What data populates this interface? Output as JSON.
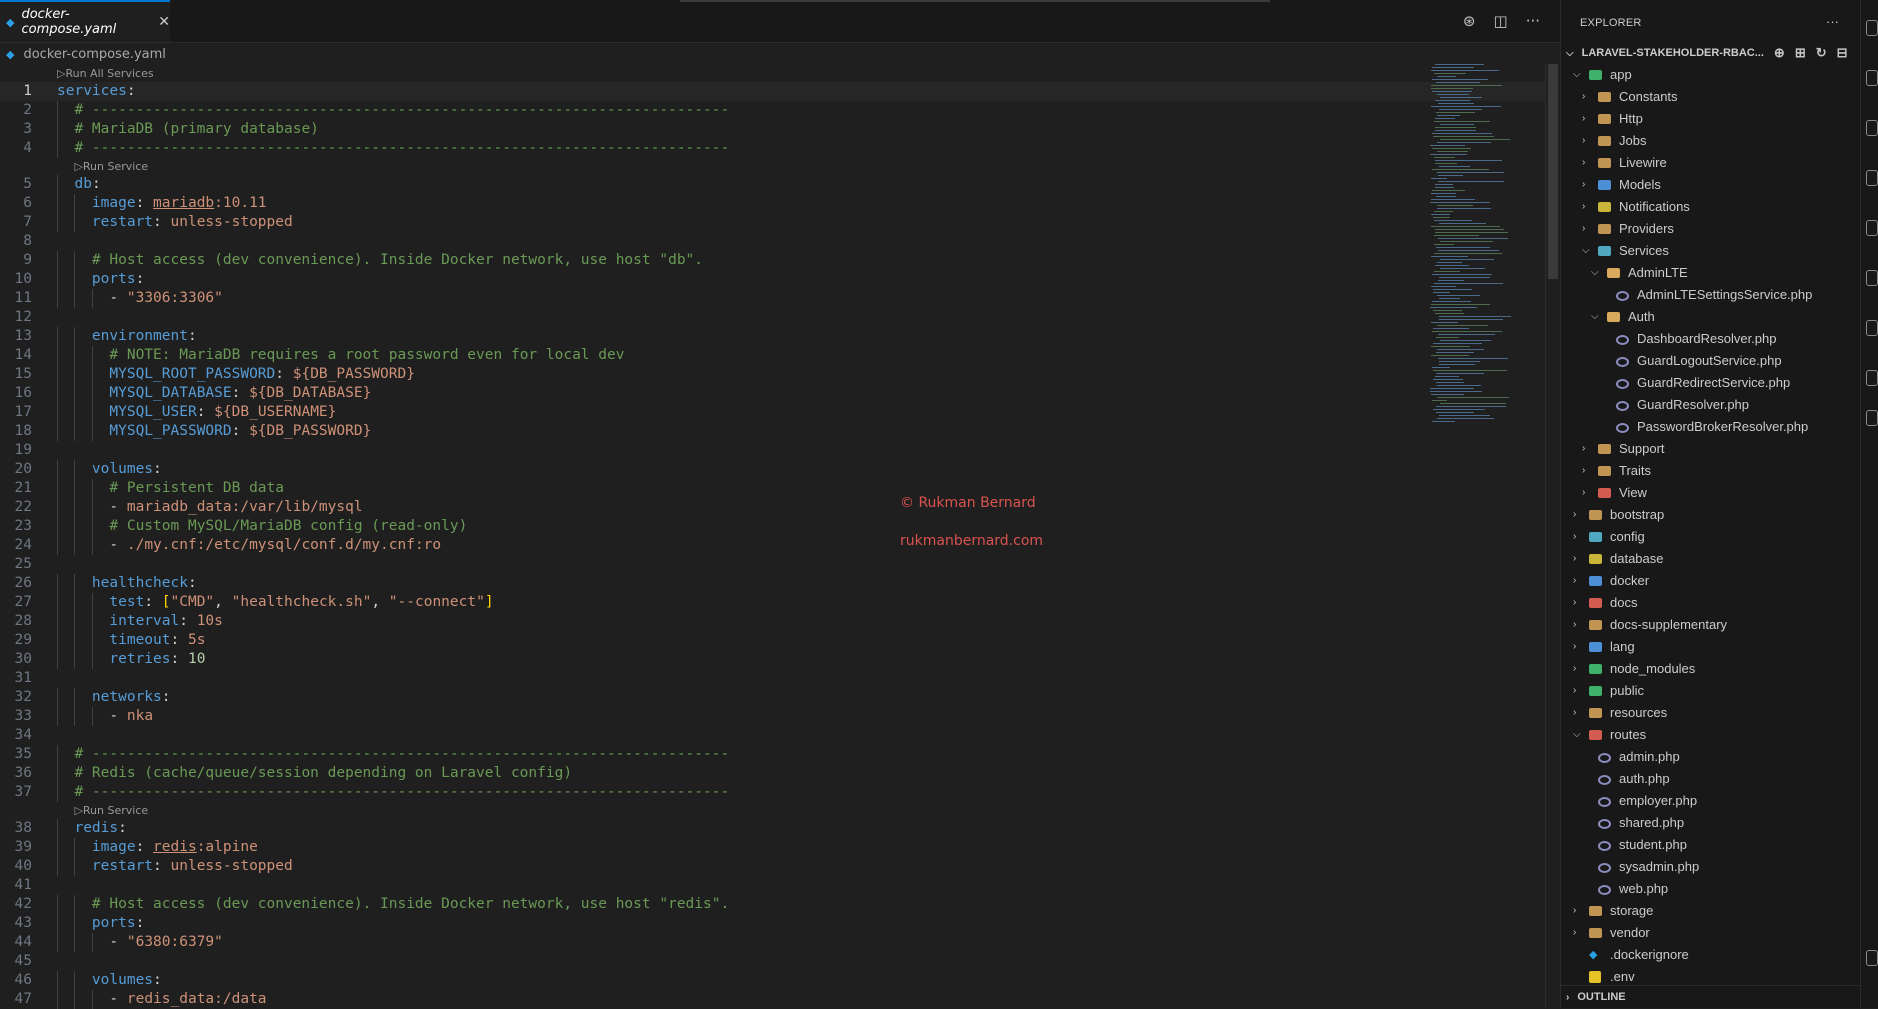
{
  "tab": {
    "label": "docker-compose.yaml",
    "close": "✕",
    "icon": "whale-icon"
  },
  "tab_actions": [
    "copilot-icon",
    "split-editor-icon",
    "more-icon"
  ],
  "breadcrumb": {
    "file": "docker-compose.yaml"
  },
  "codelens": {
    "run_all": "▷Run All Services",
    "run_service": "▷Run Service"
  },
  "code_lines": [
    {
      "n": "1",
      "t": "services:"
    },
    {
      "n": "2",
      "t": "  # -------------------------------------------------------------------------"
    },
    {
      "n": "3",
      "t": "  # MariaDB (primary database)"
    },
    {
      "n": "4",
      "t": "  # -------------------------------------------------------------------------"
    },
    {
      "n": "5",
      "t": "  db:"
    },
    {
      "n": "6",
      "t": "    image: mariadb:10.11"
    },
    {
      "n": "7",
      "t": "    restart: unless-stopped"
    },
    {
      "n": "8",
      "t": ""
    },
    {
      "n": "9",
      "t": "    # Host access (dev convenience). Inside Docker network, use host \"db\"."
    },
    {
      "n": "10",
      "t": "    ports:"
    },
    {
      "n": "11",
      "t": "      - \"3306:3306\""
    },
    {
      "n": "12",
      "t": ""
    },
    {
      "n": "13",
      "t": "    environment:"
    },
    {
      "n": "14",
      "t": "      # NOTE: MariaDB requires a root password even for local dev"
    },
    {
      "n": "15",
      "t": "      MYSQL_ROOT_PASSWORD: ${DB_PASSWORD}"
    },
    {
      "n": "16",
      "t": "      MYSQL_DATABASE: ${DB_DATABASE}"
    },
    {
      "n": "17",
      "t": "      MYSQL_USER: ${DB_USERNAME}"
    },
    {
      "n": "18",
      "t": "      MYSQL_PASSWORD: ${DB_PASSWORD}"
    },
    {
      "n": "19",
      "t": ""
    },
    {
      "n": "20",
      "t": "    volumes:"
    },
    {
      "n": "21",
      "t": "      # Persistent DB data"
    },
    {
      "n": "22",
      "t": "      - mariadb_data:/var/lib/mysql"
    },
    {
      "n": "23",
      "t": "      # Custom MySQL/MariaDB config (read-only)"
    },
    {
      "n": "24",
      "t": "      - ./my.cnf:/etc/mysql/conf.d/my.cnf:ro"
    },
    {
      "n": "25",
      "t": ""
    },
    {
      "n": "26",
      "t": "    healthcheck:"
    },
    {
      "n": "27",
      "t": "      test: [\"CMD\", \"healthcheck.sh\", \"--connect\"]"
    },
    {
      "n": "28",
      "t": "      interval: 10s"
    },
    {
      "n": "29",
      "t": "      timeout: 5s"
    },
    {
      "n": "30",
      "t": "      retries: 10"
    },
    {
      "n": "31",
      "t": ""
    },
    {
      "n": "32",
      "t": "    networks:"
    },
    {
      "n": "33",
      "t": "      - nka"
    },
    {
      "n": "34",
      "t": ""
    },
    {
      "n": "35",
      "t": "  # -------------------------------------------------------------------------"
    },
    {
      "n": "36",
      "t": "  # Redis (cache/queue/session depending on Laravel config)"
    },
    {
      "n": "37",
      "t": "  # -------------------------------------------------------------------------"
    },
    {
      "n": "38",
      "t": "  redis:"
    },
    {
      "n": "39",
      "t": "    image: redis:alpine"
    },
    {
      "n": "40",
      "t": "    restart: unless-stopped"
    },
    {
      "n": "41",
      "t": ""
    },
    {
      "n": "42",
      "t": "    # Host access (dev convenience). Inside Docker network, use host \"redis\"."
    },
    {
      "n": "43",
      "t": "    ports:"
    },
    {
      "n": "44",
      "t": "      - \"6380:6379\""
    },
    {
      "n": "45",
      "t": ""
    },
    {
      "n": "46",
      "t": "    volumes:"
    },
    {
      "n": "47",
      "t": "      - redis_data:/data"
    }
  ],
  "watermark": {
    "line1": "© Rukman Bernard",
    "line2": "rukmanbernard.com"
  },
  "explorer": {
    "header": "EXPLORER",
    "more": "···",
    "root": "LARAVEL-STAKEHOLDER-RBAC...",
    "outline": "OUTLINE",
    "tree": [
      {
        "label": "app",
        "depth": 0,
        "type": "folder",
        "open": true,
        "color": "c-green"
      },
      {
        "label": "Constants",
        "depth": 1,
        "type": "folder",
        "open": false,
        "color": "folder"
      },
      {
        "label": "Http",
        "depth": 1,
        "type": "folder",
        "open": false,
        "color": "folder"
      },
      {
        "label": "Jobs",
        "depth": 1,
        "type": "folder",
        "open": false,
        "color": "folder"
      },
      {
        "label": "Livewire",
        "depth": 1,
        "type": "folder",
        "open": false,
        "color": "folder"
      },
      {
        "label": "Models",
        "depth": 1,
        "type": "folder",
        "open": false,
        "color": "c-blue"
      },
      {
        "label": "Notifications",
        "depth": 1,
        "type": "folder",
        "open": false,
        "color": "c-yellow"
      },
      {
        "label": "Providers",
        "depth": 1,
        "type": "folder",
        "open": false,
        "color": "folder"
      },
      {
        "label": "Services",
        "depth": 1,
        "type": "folder",
        "open": true,
        "color": "c-teal"
      },
      {
        "label": "AdminLTE",
        "depth": 2,
        "type": "folder",
        "open": true,
        "color": "folder-open"
      },
      {
        "label": "AdminLTESettingsService.php",
        "depth": 3,
        "type": "php"
      },
      {
        "label": "Auth",
        "depth": 2,
        "type": "folder",
        "open": true,
        "color": "folder-open"
      },
      {
        "label": "DashboardResolver.php",
        "depth": 3,
        "type": "php"
      },
      {
        "label": "GuardLogoutService.php",
        "depth": 3,
        "type": "php"
      },
      {
        "label": "GuardRedirectService.php",
        "depth": 3,
        "type": "php"
      },
      {
        "label": "GuardResolver.php",
        "depth": 3,
        "type": "php"
      },
      {
        "label": "PasswordBrokerResolver.php",
        "depth": 3,
        "type": "php"
      },
      {
        "label": "Support",
        "depth": 1,
        "type": "folder",
        "open": false,
        "color": "folder"
      },
      {
        "label": "Traits",
        "depth": 1,
        "type": "folder",
        "open": false,
        "color": "folder"
      },
      {
        "label": "View",
        "depth": 1,
        "type": "folder",
        "open": false,
        "color": "c-red"
      },
      {
        "label": "bootstrap",
        "depth": 0,
        "type": "folder",
        "open": false,
        "color": "folder"
      },
      {
        "label": "config",
        "depth": 0,
        "type": "folder",
        "open": false,
        "color": "c-teal"
      },
      {
        "label": "database",
        "depth": 0,
        "type": "folder",
        "open": false,
        "color": "c-yellow"
      },
      {
        "label": "docker",
        "depth": 0,
        "type": "folder",
        "open": false,
        "color": "c-blue"
      },
      {
        "label": "docs",
        "depth": 0,
        "type": "folder",
        "open": false,
        "color": "c-red"
      },
      {
        "label": "docs-supplementary",
        "depth": 0,
        "type": "folder",
        "open": false,
        "color": "folder"
      },
      {
        "label": "lang",
        "depth": 0,
        "type": "folder",
        "open": false,
        "color": "c-blue"
      },
      {
        "label": "node_modules",
        "depth": 0,
        "type": "folder",
        "open": false,
        "color": "c-green"
      },
      {
        "label": "public",
        "depth": 0,
        "type": "folder",
        "open": false,
        "color": "c-green"
      },
      {
        "label": "resources",
        "depth": 0,
        "type": "folder",
        "open": false,
        "color": "folder"
      },
      {
        "label": "routes",
        "depth": 0,
        "type": "folder",
        "open": true,
        "color": "c-red"
      },
      {
        "label": "admin.php",
        "depth": 1,
        "type": "php"
      },
      {
        "label": "auth.php",
        "depth": 1,
        "type": "php"
      },
      {
        "label": "employer.php",
        "depth": 1,
        "type": "php"
      },
      {
        "label": "shared.php",
        "depth": 1,
        "type": "php"
      },
      {
        "label": "student.php",
        "depth": 1,
        "type": "php"
      },
      {
        "label": "sysadmin.php",
        "depth": 1,
        "type": "php"
      },
      {
        "label": "web.php",
        "depth": 1,
        "type": "php"
      },
      {
        "label": "storage",
        "depth": 0,
        "type": "folder",
        "open": false,
        "color": "folder"
      },
      {
        "label": "vendor",
        "depth": 0,
        "type": "folder",
        "open": false,
        "color": "folder"
      },
      {
        "label": ".dockerignore",
        "depth": 0,
        "type": "whale"
      },
      {
        "label": ".env",
        "depth": 0,
        "type": "env"
      }
    ]
  }
}
